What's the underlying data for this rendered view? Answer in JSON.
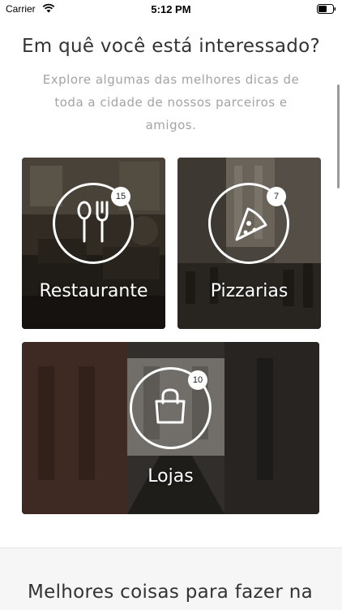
{
  "status_bar": {
    "carrier": "Carrier",
    "time": "5:12 PM"
  },
  "header": {
    "title": "Em quê você está interessado?",
    "subtitle": "Explore algumas das melhores dicas de toda a cidade de nossos parceiros e amigos."
  },
  "categories": [
    {
      "label": "Restaurante",
      "count": "15",
      "icon": "fork-spoon-icon"
    },
    {
      "label": "Pizzarias",
      "count": "7",
      "icon": "pizza-slice-icon"
    },
    {
      "label": "Lojas",
      "count": "10",
      "icon": "shopping-bag-icon"
    }
  ],
  "section2": {
    "title": "Melhores coisas para fazer na"
  }
}
